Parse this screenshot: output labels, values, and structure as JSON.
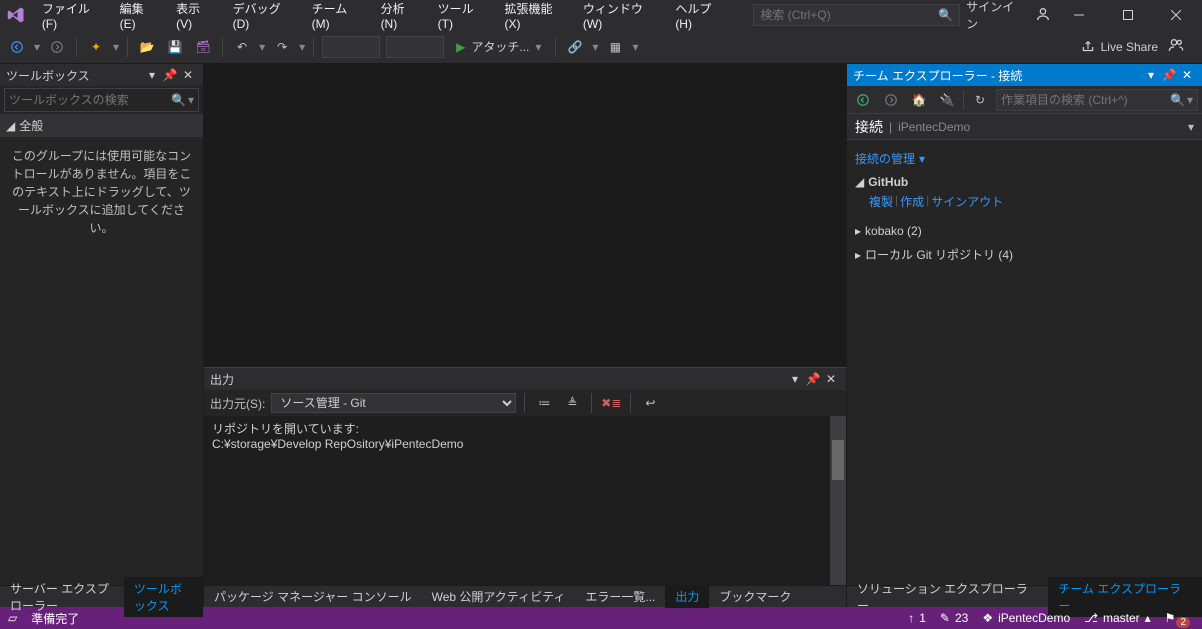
{
  "menu": {
    "file": "ファイル(F)",
    "edit": "編集(E)",
    "view": "表示(V)",
    "debug": "デバッグ(D)",
    "team": "チーム(M)",
    "analyze": "分析(N)",
    "tools": "ツール(T)",
    "extensions": "拡張機能(X)",
    "window": "ウィンドウ(W)",
    "help": "ヘルプ(H)"
  },
  "title_search_placeholder": "検索 (Ctrl+Q)",
  "signin": "サインイン",
  "toolbar": {
    "attach": "アタッチ...",
    "live_share": "Live Share"
  },
  "toolbox": {
    "title": "ツールボックス",
    "search_placeholder": "ツールボックスの検索",
    "section": "全般",
    "empty_msg": "このグループには使用可能なコントロールがありません。項目をこのテキスト上にドラッグして、ツールボックスに追加してください。"
  },
  "output": {
    "title": "出力",
    "source_label": "出力元(S):",
    "source_value": "ソース管理 - Git",
    "line1": "リポジトリを開いています:",
    "line2": "C:¥storage¥Develop RepOsitory¥iPentecDemo"
  },
  "center_tabs": {
    "pkg_mgr": "パッケージ マネージャー コンソール",
    "web_publish": "Web 公開アクティビティ",
    "errors": "エラー一覧...",
    "output": "出力",
    "bookmark": "ブックマーク"
  },
  "left_tabs": {
    "server_explorer": "サーバー エクスプローラー",
    "toolbox": "ツールボックス"
  },
  "right_tabs": {
    "solution": "ソリューション エクスプローラー",
    "team": "チーム エクスプローラー"
  },
  "team_explorer": {
    "title": "チーム エクスプローラー - 接続",
    "search_placeholder": "作業項目の検索 (Ctrl+^)",
    "connect_label": "接続",
    "project": "iPentecDemo",
    "manage_link": "接続の管理",
    "github": "GitHub",
    "gh_clone": "複製",
    "gh_create": "作成",
    "gh_signout": "サインアウト",
    "repo1": "kobako (2)",
    "repo2": "ローカル Git リポジトリ (4)"
  },
  "status": {
    "ready": "準備完了",
    "up": "1",
    "rev": "23",
    "repo": "iPentecDemo",
    "branch": "master",
    "notif": "2"
  }
}
